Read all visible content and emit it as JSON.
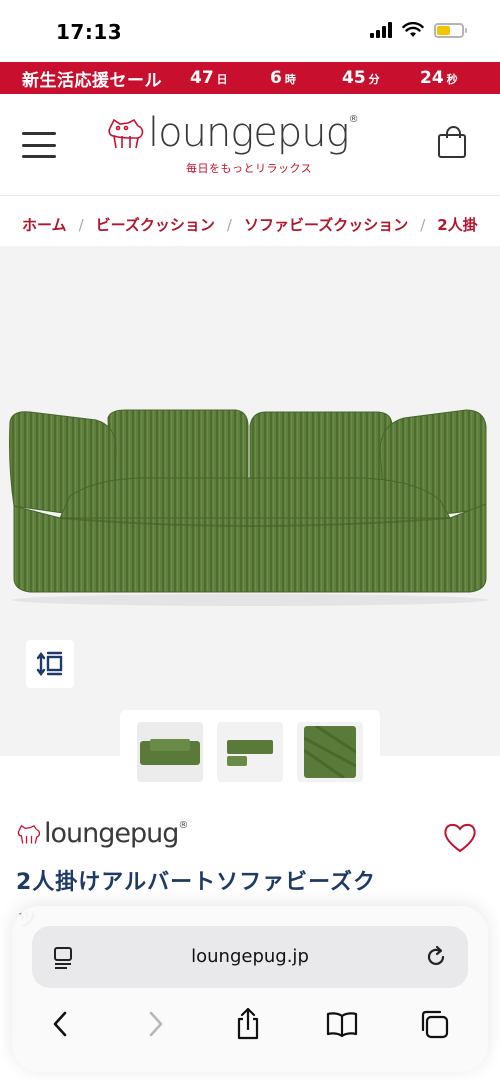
{
  "status": {
    "time": "17:13"
  },
  "sale": {
    "title": "新生活応援セール",
    "days": "47",
    "days_unit": "日",
    "hours": "6",
    "hours_unit": "時",
    "minutes": "45",
    "minutes_unit": "分",
    "seconds": "24",
    "seconds_unit": "秒"
  },
  "header": {
    "logo": "loungepug",
    "tagline": "毎日をもっとリラックス"
  },
  "breadcrumb": [
    "ホーム",
    "ビーズクッション",
    "ソファビーズクッション",
    "2人掛"
  ],
  "product": {
    "brand": "loungepug",
    "title": "2人掛けアルバートソファビーズク",
    "title_peek": "ッ",
    "sofa_color": "#5a7a3a"
  },
  "browser": {
    "url": "loungepug.jp"
  },
  "colors": {
    "accent": "#c8102e",
    "title": "#1e3a66"
  }
}
